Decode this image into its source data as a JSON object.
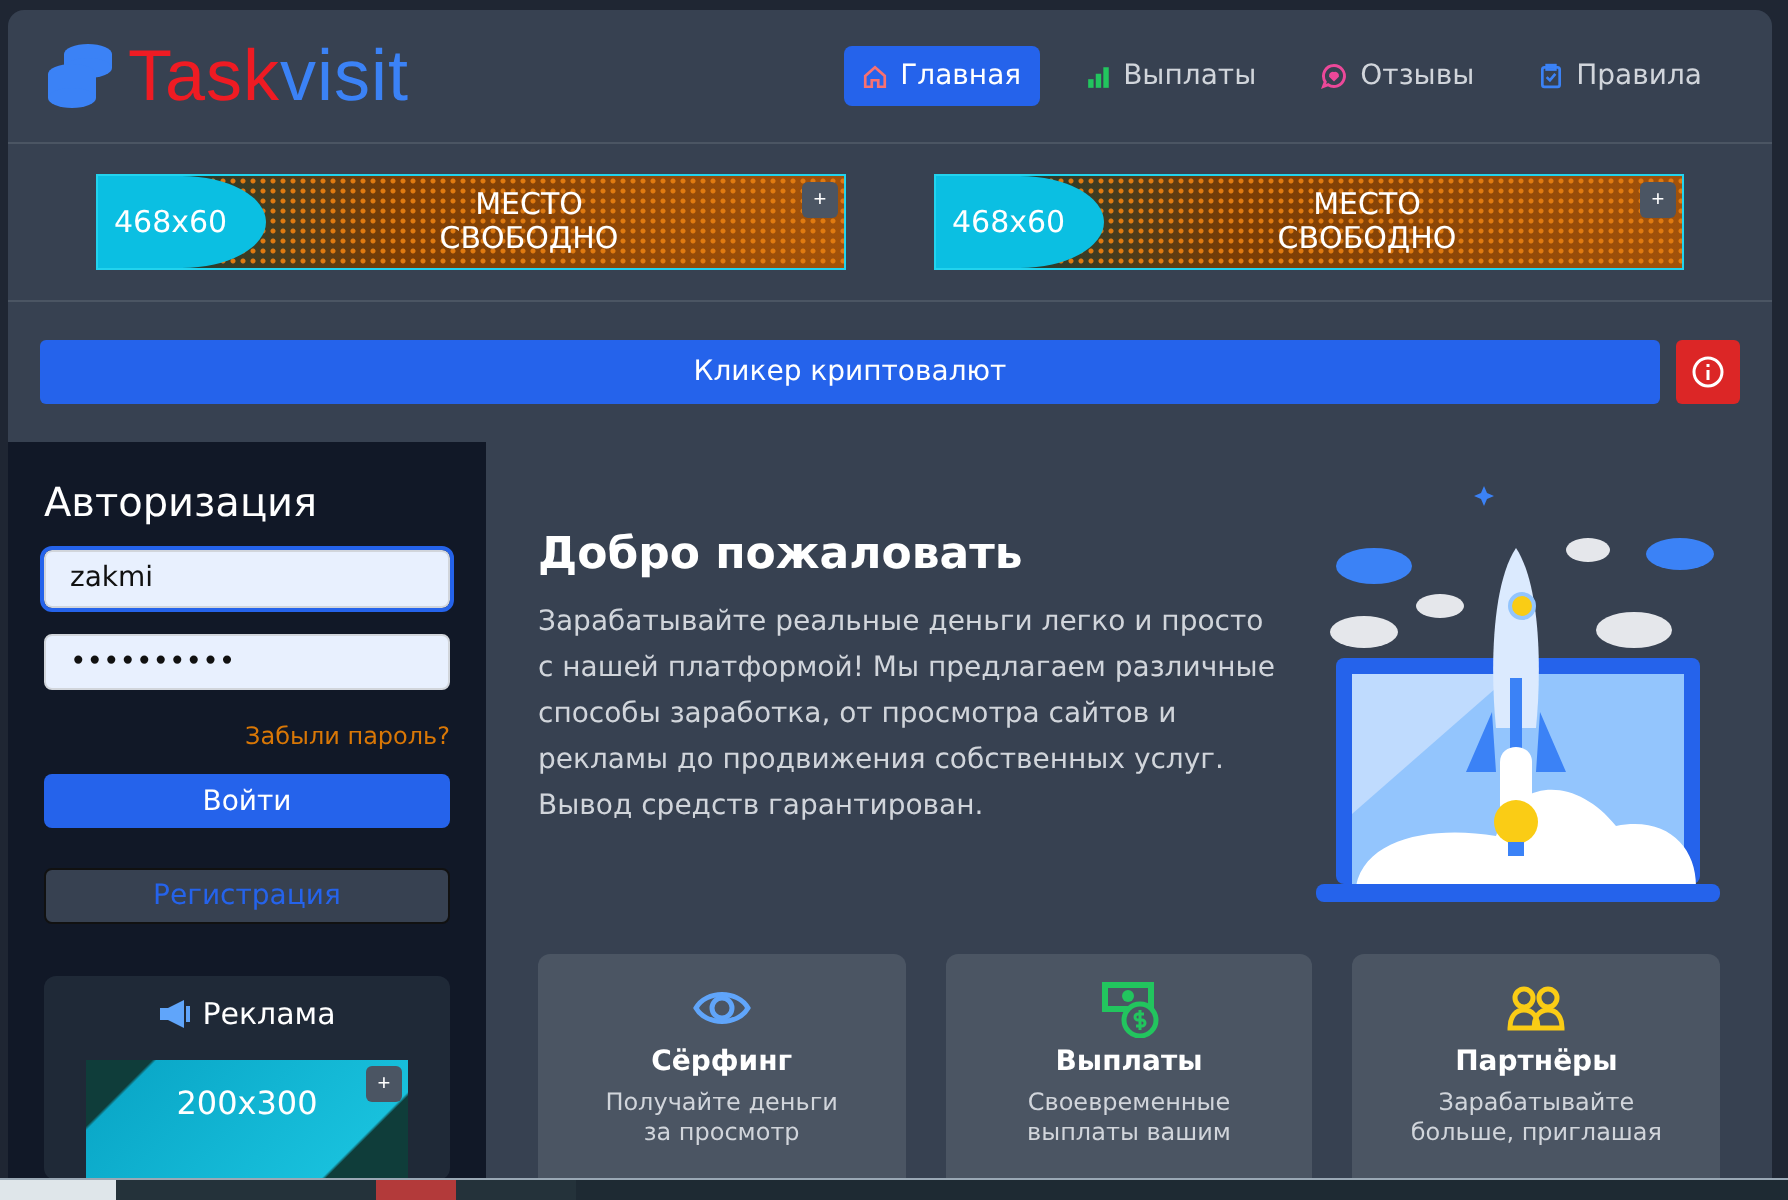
{
  "logo": {
    "first": "Task",
    "second": "visit"
  },
  "nav": [
    {
      "label": "Главная",
      "selected": true
    },
    {
      "label": "Выплаты",
      "selected": false
    },
    {
      "label": "Отзывы",
      "selected": false
    },
    {
      "label": "Правила",
      "selected": false
    }
  ],
  "banners": [
    {
      "size": "468x60",
      "lines": [
        "МЕСТО",
        "СВОБОДНО"
      ],
      "action": "+"
    },
    {
      "size": "468x60",
      "lines": [
        "МЕСТО",
        "СВОБОДНО"
      ],
      "action": "+"
    }
  ],
  "clicker": {
    "label": "Кликер криптовалют"
  },
  "login": {
    "title": "Авторизация",
    "username": "zakmi",
    "password": "••••••••••",
    "forgot": "Забыли пароль?",
    "submit": "Войти",
    "register": "Регистрация"
  },
  "ad": {
    "title": "Реклама",
    "size": "200x300",
    "action": "+"
  },
  "welcome": {
    "title": "Добро пожаловать",
    "text": "Зарабатывайте реальные деньги легко и просто с нашей платформой! Мы предлагаем различные способы заработка, от просмотра сайтов и рекламы до продвижения собственных услуг. Вывод средств гарантирован."
  },
  "features": [
    {
      "title": "Сёрфинг",
      "lines": [
        "Получайте деньги",
        "за просмотр"
      ]
    },
    {
      "title": "Выплаты",
      "lines": [
        "Своевременные",
        "выплаты вашим"
      ]
    },
    {
      "title": "Партнёры",
      "lines": [
        "Зарабатывайте",
        "больше, приглашая"
      ]
    }
  ]
}
